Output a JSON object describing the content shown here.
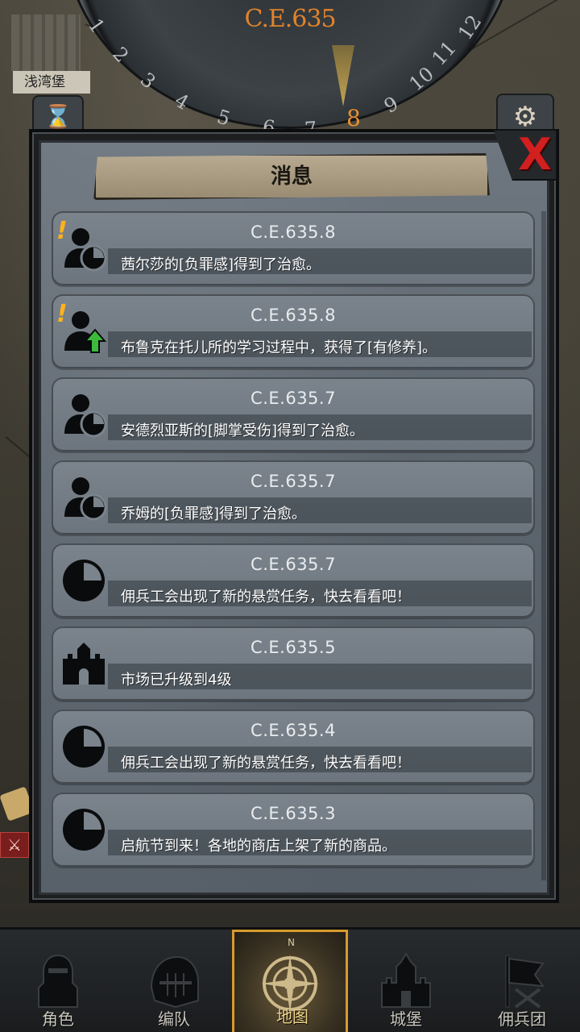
{
  "calendar": {
    "year": "C.E.635",
    "months": [
      "1",
      "2",
      "3",
      "4",
      "5",
      "6",
      "7",
      "8",
      "9",
      "10",
      "11",
      "12"
    ],
    "current_month": "8"
  },
  "location": {
    "name": "浅湾堡"
  },
  "dialog": {
    "title": "消息",
    "close_label": "X"
  },
  "messages": [
    {
      "date": "C.E.635.8",
      "text": "茜尔莎的[负罪感]得到了治愈。",
      "icon": "person-heal-icon",
      "alert": "!"
    },
    {
      "date": "C.E.635.8",
      "text": "布鲁克在托儿所的学习过程中，获得了[有修养]。",
      "icon": "person-levelup-icon",
      "alert": "!"
    },
    {
      "date": "C.E.635.7",
      "text": "安德烈亚斯的[脚掌受伤]得到了治愈。",
      "icon": "person-heal-icon",
      "alert": ""
    },
    {
      "date": "C.E.635.7",
      "text": "乔姆的[负罪感]得到了治愈。",
      "icon": "person-heal-icon",
      "alert": ""
    },
    {
      "date": "C.E.635.7",
      "text": "佣兵工会出现了新的悬赏任务，快去看看吧！",
      "icon": "clock-icon",
      "alert": ""
    },
    {
      "date": "C.E.635.5",
      "text": "市场已升级到4级",
      "icon": "castle-icon",
      "alert": ""
    },
    {
      "date": "C.E.635.4",
      "text": "佣兵工会出现了新的悬赏任务，快去看看吧！",
      "icon": "clock-icon",
      "alert": ""
    },
    {
      "date": "C.E.635.3",
      "text": "启航节到来！各地的商店上架了新的商品。",
      "icon": "clock-icon",
      "alert": ""
    }
  ],
  "nav": [
    {
      "label": "角色",
      "icon": "knight-icon",
      "active": false
    },
    {
      "label": "编队",
      "icon": "helmet-icon",
      "active": false
    },
    {
      "label": "地图",
      "icon": "compass-icon",
      "active": true
    },
    {
      "label": "城堡",
      "icon": "castle-icon",
      "active": false
    },
    {
      "label": "佣兵团",
      "icon": "banner-icon",
      "active": false
    }
  ],
  "colors": {
    "accent": "#e0832c",
    "alert": "#ffb21c",
    "close": "#d21f1f",
    "levelup": "#3cba3c",
    "active_nav_border": "#d89a2c"
  }
}
